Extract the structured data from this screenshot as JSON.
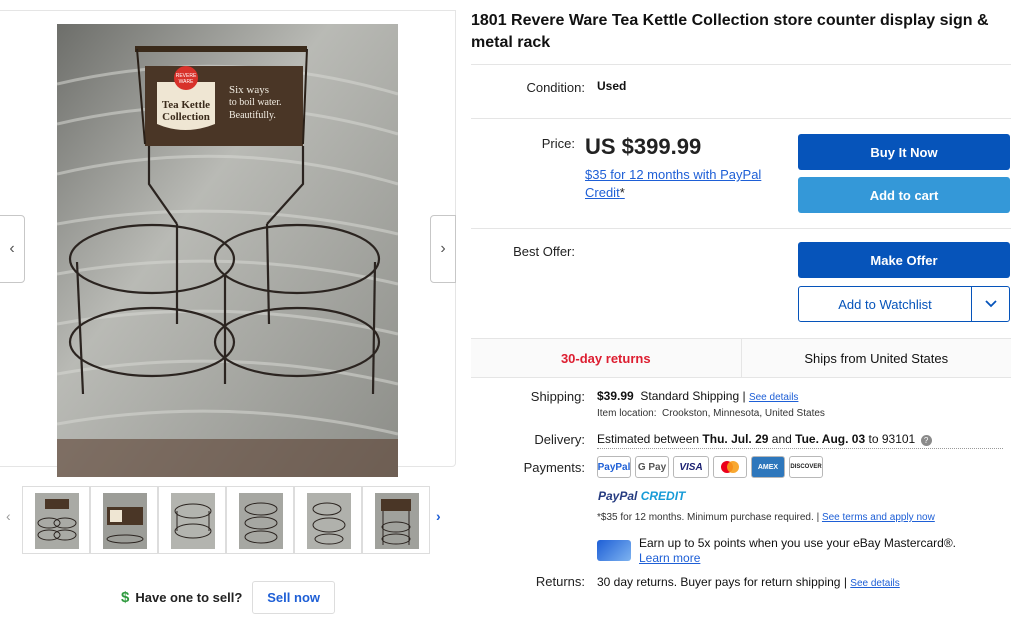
{
  "listing": {
    "title": "1801 Revere Ware Tea Kettle Collection store counter display sign & metal rack"
  },
  "photo": {
    "sign_line1": "REVERE",
    "sign_line2": "WARE",
    "sign_name1": "Tea Kettle",
    "sign_name2": "Collection",
    "sign_tag1": "Six ways",
    "sign_tag2": "to boil water.",
    "sign_tag3": "Beautifully.",
    "prev_glyph": "‹",
    "next_glyph": "›"
  },
  "thumbnails": {
    "left_glyph": "‹",
    "right_glyph": "›",
    "count": 6
  },
  "sell": {
    "dollar": "$",
    "prompt": "Have one to sell?",
    "button": "Sell now"
  },
  "condition": {
    "label": "Condition:",
    "value": "Used"
  },
  "price": {
    "label": "Price:",
    "value": "US $399.99",
    "credit_text": "$35 for 12 months with PayPal Credit",
    "credit_star": "*"
  },
  "buttons": {
    "buy_now": "Buy It Now",
    "add_to_cart": "Add to cart",
    "make_offer": "Make Offer",
    "watchlist": "Add to Watchlist",
    "watchlist_chevron": "⌄"
  },
  "best_offer": {
    "label": "Best Offer:"
  },
  "highlights": {
    "returns": "30-day returns",
    "ships_from": "Ships from United States"
  },
  "shipping": {
    "label": "Shipping:",
    "cost": "$39.99",
    "method": "Standard Shipping",
    "separator": "|",
    "details_link": "See details",
    "location_label": "Item location:",
    "location": "Crookston, Minnesota, United States"
  },
  "delivery": {
    "label": "Delivery:",
    "prefix": "Estimated between",
    "date1": "Thu. Jul. 29",
    "and": "and",
    "date2": "Tue. Aug. 03",
    "to": "to 93101",
    "info_glyph": "?"
  },
  "payments": {
    "label": "Payments:",
    "cards": [
      "PayPal",
      "G Pay",
      "VISA",
      "",
      "AMEX",
      "DISCOVER"
    ],
    "paypal_credit_1": "PayPal",
    "paypal_credit_2": "CREDIT",
    "terms": "*$35 for 12 months. Minimum purchase required.",
    "terms_sep": "|",
    "terms_link": "See terms and apply now",
    "mc_promo": "Earn up to 5x points when you use your eBay Mastercard®.",
    "learn_more": "Learn more"
  },
  "returns": {
    "label": "Returns:",
    "text": "30 day returns. Buyer pays for return shipping",
    "separator": "|",
    "details_link": "See details"
  },
  "colors": {
    "primary_blue": "#0654ba",
    "light_blue": "#3498d8",
    "returns_red": "#dd1e31",
    "sell_green": "#2e9a3e"
  }
}
